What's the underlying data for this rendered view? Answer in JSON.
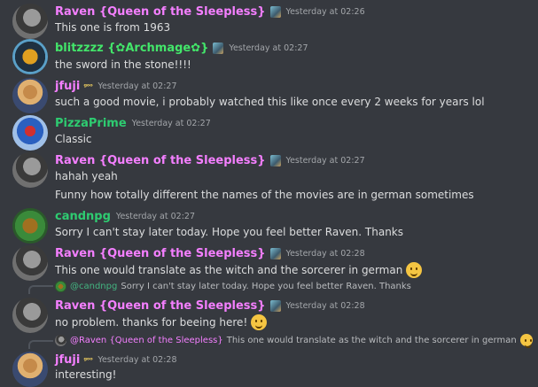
{
  "messages": [
    {
      "author": "Raven {Queen of the Sleepless}",
      "timestamp": "Yesterday at 02:26",
      "lines": [
        "This one is from 1963"
      ]
    },
    {
      "author": "blitzzzz {✿Archmage✿}",
      "timestamp": "Yesterday at 02:27",
      "lines": [
        "the sword in the stone!!!!"
      ]
    },
    {
      "author": "jfuji",
      "badge": "ᵍᵒᵒ",
      "timestamp": "Yesterday at 02:27",
      "lines": [
        "such a good movie, i probably watched this like once every 2 weeks for years lol"
      ]
    },
    {
      "author": "PizzaPrime",
      "timestamp": "Yesterday at 02:27",
      "lines": [
        "Classic"
      ]
    },
    {
      "author": "Raven {Queen of the Sleepless}",
      "timestamp": "Yesterday at 02:27",
      "lines": [
        "hahah yeah",
        "Funny how totally different the names of the movies are in german sometimes"
      ]
    },
    {
      "author": "candnpg",
      "timestamp": "Yesterday at 02:27",
      "lines": [
        "Sorry I can't stay later today.  Hope you feel better Raven.  Thanks"
      ]
    },
    {
      "author": "Raven {Queen of the Sleepless}",
      "timestamp": "Yesterday at 02:28",
      "lines": [
        "This one would translate as the witch and the sorcerer in german"
      ],
      "emoji": "grinning-emoji"
    },
    {
      "reply_to": "@candnpg",
      "reply_text": "Sorry I can't stay later today.  Hope you feel better Raven.  Thanks",
      "author": "Raven {Queen of the Sleepless}",
      "timestamp": "Yesterday at 02:28",
      "lines": [
        "no problem. thanks for beeing here!"
      ],
      "emoji": "slight-smile-emoji"
    },
    {
      "reply_to": "@Raven {Queen of the Sleepless}",
      "reply_text": "This one would translate as the witch and the sorcerer in german",
      "author": "jfuji",
      "badge": "ᵍᵒᵒ",
      "timestamp": "Yesterday at 02:28",
      "lines": [
        "interesting!"
      ]
    }
  ]
}
